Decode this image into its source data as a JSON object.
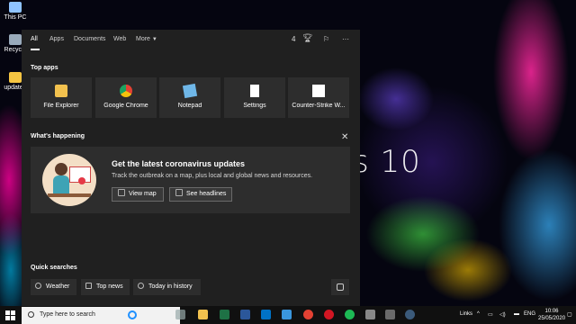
{
  "desktop": {
    "brand_text": "s 10",
    "icons": [
      {
        "label": "This PC",
        "color": "#8fc3ff"
      },
      {
        "label": "Recycle",
        "color": "#9ab"
      },
      {
        "label": "updated",
        "color": "#f5c542"
      }
    ]
  },
  "search_panel": {
    "tabs": [
      "All",
      "Apps",
      "Documents",
      "Web",
      "More"
    ],
    "active_tab": "All",
    "rewards_count": "4",
    "more_options": "···",
    "top_apps_label": "Top apps",
    "top_apps": [
      {
        "label": "File Explorer",
        "icon": "folder-icon",
        "color": "#f2c14e"
      },
      {
        "label": "Google Chrome",
        "icon": "chrome-icon",
        "color": "#e34133"
      },
      {
        "label": "Notepad",
        "icon": "notepad-icon",
        "color": "#6fb7e8"
      },
      {
        "label": "Settings",
        "icon": "settings-icon",
        "color": "#ffffff"
      },
      {
        "label": "Counter-Strike W...",
        "icon": "counter-strike-icon",
        "color": "#ffffff"
      }
    ],
    "whats_happening_label": "What's happening",
    "news": {
      "title": "Get the latest coronavirus updates",
      "description": "Track the outbreak on a map, plus local and global news and resources.",
      "buttons": [
        "View map",
        "See headlines"
      ]
    },
    "quick_searches_label": "Quick searches",
    "quick_searches": [
      "Weather",
      "Top news",
      "Today in history"
    ]
  },
  "taskbar": {
    "search_placeholder": "Type here to search",
    "pinned_apps": [
      {
        "icon": "task-view-icon",
        "color": "#9aa"
      },
      {
        "icon": "file-explorer-icon",
        "color": "#f2c14e"
      },
      {
        "icon": "excel-icon",
        "color": "#1e7145"
      },
      {
        "icon": "word-icon",
        "color": "#2b579a"
      },
      {
        "icon": "outlook-icon",
        "color": "#0072c6"
      },
      {
        "icon": "store-icon",
        "color": "#3a96dd"
      },
      {
        "icon": "chrome-icon",
        "color": "#e34133"
      },
      {
        "icon": "opera-icon",
        "color": "#d21623"
      },
      {
        "icon": "spotify-icon",
        "color": "#1db954"
      },
      {
        "icon": "app-icon",
        "color": "#888888"
      },
      {
        "icon": "app-icon-2",
        "color": "#6a6a6a"
      },
      {
        "icon": "steam-icon",
        "color": "#3b5a7a"
      }
    ],
    "tray": {
      "links": "Links",
      "lang": "ENG"
    },
    "clock": {
      "time": "10:06",
      "date": "25/05/2020"
    }
  }
}
